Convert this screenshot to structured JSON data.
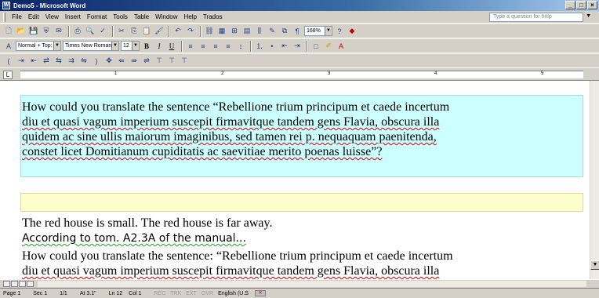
{
  "window": {
    "title": "Demo5 - Microsoft Word",
    "app_icon": "W",
    "buttons": [
      "_",
      "□",
      "×"
    ]
  },
  "menubar": {
    "items": [
      "File",
      "Edit",
      "View",
      "Insert",
      "Format",
      "Tools",
      "Table",
      "Window",
      "Help",
      "Trados"
    ],
    "ask_placeholder": "Type a question for help"
  },
  "toolbar": {
    "zoom": "168%",
    "style": "Normal + Top: (",
    "font": "Times New Roman",
    "size": "12",
    "bold": "B",
    "italic": "I",
    "underline": "U"
  },
  "ruler": {
    "numbers": [
      "1",
      "2",
      "3",
      "4",
      "5"
    ]
  },
  "document": {
    "para1_lines": [
      "How could you translate the sentence “Rebellione trium principum et caede incertum",
      "diu et quasi vagum imperium suscepit firmavitque tandem gens Flavia, obscura illa",
      "quidem ac sine ullis maiorum imaginibus, sed tamen rei p. nequaquam paenitenda,",
      "constet licet Domitianum cupiditatis ac saevitiae merito poenas luisse”?"
    ],
    "line_red_house": "The red house is small. The red house is far away.",
    "line_according": "According to tom. A2.3A of the manual...",
    "para2_lines": [
      "How could you translate the sentence: “Rebellione trium principum et caede incertum",
      "diu et quasi vagum imperium suscepit firmavitque tandem gens Flavia, obscura illa"
    ]
  },
  "statusbar": {
    "page": "Page 1",
    "sec": "Sec 1",
    "of": "1/1",
    "at": "At 3.1\"",
    "ln": "Ln 12",
    "col": "Col 1",
    "rec": "REC",
    "trk": "TRK",
    "ext": "EXT",
    "ovr": "OVR",
    "lang": "English (U.S"
  }
}
